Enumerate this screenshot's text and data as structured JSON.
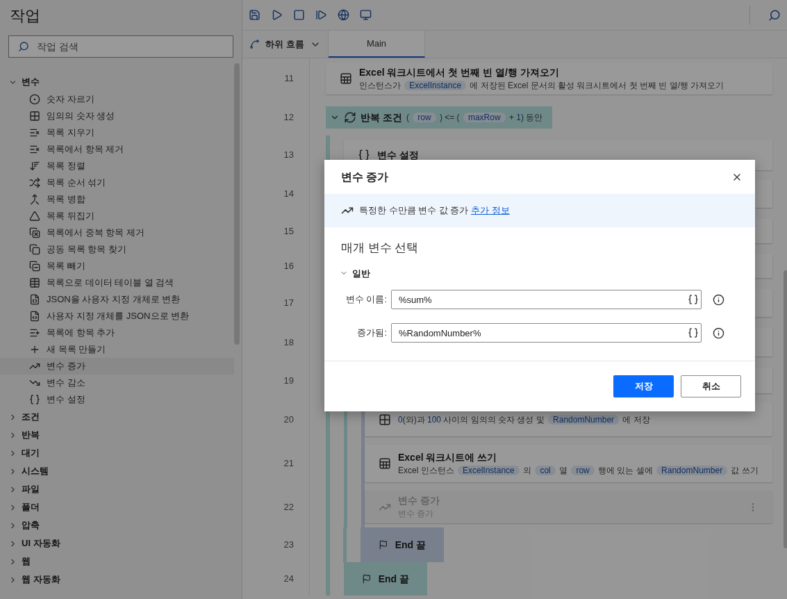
{
  "sidebar": {
    "title": "작업",
    "search": {
      "placeholder": "작업 검색"
    },
    "groups": [
      {
        "label": "변수",
        "expanded": true,
        "children": [
          {
            "label": "숫자 자르기",
            "selected": false
          },
          {
            "label": "임의의 숫자 생성",
            "selected": false
          },
          {
            "label": "목록 지우기",
            "selected": false
          },
          {
            "label": "목록에서 항목 제거",
            "selected": false
          },
          {
            "label": "목록 정렬",
            "selected": false
          },
          {
            "label": "목록 순서 섞기",
            "selected": false
          },
          {
            "label": "목록 병합",
            "selected": false
          },
          {
            "label": "목록 뒤집기",
            "selected": false
          },
          {
            "label": "목록에서 중복 항목 제거",
            "selected": false
          },
          {
            "label": "공동 목록 항목 찾기",
            "selected": false
          },
          {
            "label": "목록 빼기",
            "selected": false
          },
          {
            "label": "목록으로 데이터 테이블 열 검색",
            "selected": false
          },
          {
            "label": "JSON을 사용자 지정 개체로 변환",
            "selected": false
          },
          {
            "label": "사용자 지정 개체를 JSON으로 변환",
            "selected": false
          },
          {
            "label": "목록에 항목 추가",
            "selected": false
          },
          {
            "label": "새 목록 만들기",
            "selected": false
          },
          {
            "label": "변수 증가",
            "selected": true
          },
          {
            "label": "변수 감소",
            "selected": false
          },
          {
            "label": "변수 설정",
            "selected": false
          }
        ]
      },
      {
        "label": "조건",
        "expanded": false
      },
      {
        "label": "반복",
        "expanded": false
      },
      {
        "label": "대기",
        "expanded": false
      },
      {
        "label": "시스템",
        "expanded": false
      },
      {
        "label": "파일",
        "expanded": false
      },
      {
        "label": "폴더",
        "expanded": false
      },
      {
        "label": "압축",
        "expanded": false
      },
      {
        "label": "UI 자동화",
        "expanded": false
      },
      {
        "label": "웹",
        "expanded": false
      },
      {
        "label": "웹 자동화",
        "expanded": false
      }
    ]
  },
  "tabs": [
    {
      "label": "하위 흐름",
      "kind": "dropdown",
      "selected": false
    },
    {
      "label": "Main",
      "kind": "tab",
      "selected": true
    }
  ],
  "steps": [
    {
      "number": "11",
      "kind": "action",
      "title": "Excel 워크시트에서 첫 번째 빈 열/행 가져오기",
      "disabled": false,
      "description": [
        {
          "kind": "text",
          "text": "인스턴스가 "
        },
        {
          "kind": "var",
          "text": "ExcelInstance"
        },
        {
          "kind": "text",
          "text": " 에 저장된 Excel 문서의 활성 워크시트에서 첫 번째 빈 열/행 가져오기"
        }
      ]
    },
    {
      "number": "12",
      "kind": "loop",
      "title": "반복 조건",
      "expanded": true,
      "description": [
        {
          "kind": "text",
          "text": " ( "
        },
        {
          "kind": "var",
          "text": "row"
        },
        {
          "kind": "text",
          "text": " ) <= ( "
        },
        {
          "kind": "var",
          "text": "maxRow"
        },
        {
          "kind": "text",
          "text": " + "
        },
        {
          "kind": "number",
          "text": "1"
        },
        {
          "kind": "text",
          "text": ") 동안"
        }
      ]
    },
    {
      "number": "13",
      "kind": "action",
      "title": "변수 설정",
      "disabled": false
    },
    {
      "number": "14",
      "kind": "hidden"
    },
    {
      "number": "15",
      "kind": "hidden"
    },
    {
      "number": "16",
      "kind": "hidden"
    },
    {
      "number": "17",
      "kind": "hidden"
    },
    {
      "number": "18",
      "kind": "hidden"
    },
    {
      "number": "19",
      "kind": "hidden"
    },
    {
      "number": "20",
      "kind": "action",
      "disabled": false,
      "description": [
        {
          "kind": "number",
          "text": "0"
        },
        {
          "kind": "text",
          "text": "(와)과 "
        },
        {
          "kind": "number",
          "text": "100"
        },
        {
          "kind": "text",
          "text": " 사이의 임의의 숫자 생성 및 "
        },
        {
          "kind": "var",
          "text": "RandomNumber"
        },
        {
          "kind": "text",
          "text": " 에 저장"
        }
      ]
    },
    {
      "number": "21",
      "kind": "action",
      "title": "Excel 워크시트에 쓰기",
      "disabled": false,
      "description": [
        {
          "kind": "text",
          "text": "Excel 인스턴스 "
        },
        {
          "kind": "var",
          "text": "ExcelInstance"
        },
        {
          "kind": "text",
          "text": " 의 "
        },
        {
          "kind": "var",
          "text": "col"
        },
        {
          "kind": "text",
          "text": " 열 "
        },
        {
          "kind": "var",
          "text": "row"
        },
        {
          "kind": "text",
          "text": " 행에 있는 셀에 "
        },
        {
          "kind": "var",
          "text": "RandomNumber"
        },
        {
          "kind": "text",
          "text": " 값 쓰기"
        }
      ]
    },
    {
      "number": "22",
      "kind": "action",
      "title": "변수 증가",
      "disabled": true,
      "description": [
        {
          "kind": "text",
          "text": "변수 증가"
        }
      ]
    },
    {
      "number": "23",
      "kind": "end",
      "title": "End 끝"
    },
    {
      "number": "24",
      "kind": "end",
      "title": "End 끝"
    }
  ],
  "dialog": {
    "title": "변수 증가",
    "info": {
      "text": "특정한 수만큼 변수 값 증가 ",
      "link": "추가 정보"
    },
    "section": "매개 변수 선택",
    "group": {
      "label": "일반",
      "expanded": true
    },
    "fields": [
      {
        "label": "변수 이름:",
        "value": "%sum%"
      },
      {
        "label": "증가됨:",
        "value": "%RandomNumber%"
      }
    ],
    "buttons": [
      {
        "label": "저장",
        "kind": "primary"
      },
      {
        "label": "취소",
        "kind": "secondary"
      }
    ]
  }
}
